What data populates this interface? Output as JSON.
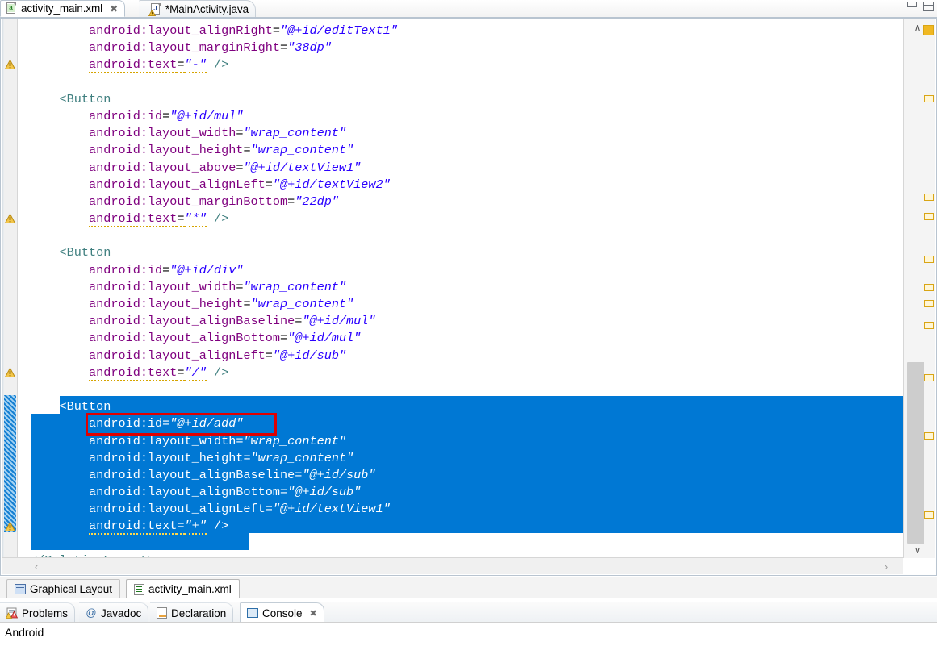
{
  "window": {
    "minimize_label": "Minimize",
    "maximize_label": "Maximize"
  },
  "editor_tabs": [
    {
      "label": "activity_main.xml",
      "icon": "xml-file-icon",
      "active": true,
      "close_glyph": "✖",
      "dirty": false
    },
    {
      "label": "*MainActivity.java",
      "icon": "java-file-icon",
      "active": false,
      "close_glyph": "",
      "dirty": true
    }
  ],
  "code": {
    "lines": [
      {
        "indent": 2,
        "segments": [
          {
            "t": "attr",
            "s": "android:layout_alignRight"
          },
          {
            "t": "punc",
            "s": "="
          },
          {
            "t": "val",
            "s": "\"@+id/editText1\""
          }
        ]
      },
      {
        "indent": 2,
        "segments": [
          {
            "t": "attr",
            "s": "android:layout_marginRight"
          },
          {
            "t": "punc",
            "s": "="
          },
          {
            "t": "val",
            "s": "\"38dp\""
          }
        ]
      },
      {
        "indent": 2,
        "warn": true,
        "segments": [
          {
            "t": "attr",
            "s": "android:text",
            "squig": true
          },
          {
            "t": "punc",
            "s": "=",
            "squig": true
          },
          {
            "t": "val",
            "s": "\"-\"",
            "squig": true
          },
          {
            "t": "plain",
            "s": " "
          },
          {
            "t": "slash",
            "s": "/>"
          }
        ]
      },
      {
        "indent": 0,
        "segments": []
      },
      {
        "indent": 1,
        "segments": [
          {
            "t": "tag",
            "s": "<Button"
          }
        ]
      },
      {
        "indent": 2,
        "segments": [
          {
            "t": "attr",
            "s": "android:id"
          },
          {
            "t": "punc",
            "s": "="
          },
          {
            "t": "val",
            "s": "\"@+id/mul\""
          }
        ]
      },
      {
        "indent": 2,
        "segments": [
          {
            "t": "attr",
            "s": "android:layout_width"
          },
          {
            "t": "punc",
            "s": "="
          },
          {
            "t": "val",
            "s": "\"wrap_content\""
          }
        ]
      },
      {
        "indent": 2,
        "segments": [
          {
            "t": "attr",
            "s": "android:layout_height"
          },
          {
            "t": "punc",
            "s": "="
          },
          {
            "t": "val",
            "s": "\"wrap_content\""
          }
        ]
      },
      {
        "indent": 2,
        "segments": [
          {
            "t": "attr",
            "s": "android:layout_above"
          },
          {
            "t": "punc",
            "s": "="
          },
          {
            "t": "val",
            "s": "\"@+id/textView1\""
          }
        ]
      },
      {
        "indent": 2,
        "segments": [
          {
            "t": "attr",
            "s": "android:layout_alignLeft"
          },
          {
            "t": "punc",
            "s": "="
          },
          {
            "t": "val",
            "s": "\"@+id/textView2\""
          }
        ]
      },
      {
        "indent": 2,
        "segments": [
          {
            "t": "attr",
            "s": "android:layout_marginBottom"
          },
          {
            "t": "punc",
            "s": "="
          },
          {
            "t": "val",
            "s": "\"22dp\""
          }
        ]
      },
      {
        "indent": 2,
        "warn": true,
        "segments": [
          {
            "t": "attr",
            "s": "android:text",
            "squig": true
          },
          {
            "t": "punc",
            "s": "=",
            "squig": true
          },
          {
            "t": "val",
            "s": "\"*\"",
            "squig": true
          },
          {
            "t": "plain",
            "s": " "
          },
          {
            "t": "slash",
            "s": "/>"
          }
        ]
      },
      {
        "indent": 0,
        "segments": []
      },
      {
        "indent": 1,
        "segments": [
          {
            "t": "tag",
            "s": "<Button"
          }
        ]
      },
      {
        "indent": 2,
        "segments": [
          {
            "t": "attr",
            "s": "android:id"
          },
          {
            "t": "punc",
            "s": "="
          },
          {
            "t": "val",
            "s": "\"@+id/div\""
          }
        ]
      },
      {
        "indent": 2,
        "segments": [
          {
            "t": "attr",
            "s": "android:layout_width"
          },
          {
            "t": "punc",
            "s": "="
          },
          {
            "t": "val",
            "s": "\"wrap_content\""
          }
        ]
      },
      {
        "indent": 2,
        "segments": [
          {
            "t": "attr",
            "s": "android:layout_height"
          },
          {
            "t": "punc",
            "s": "="
          },
          {
            "t": "val",
            "s": "\"wrap_content\""
          }
        ]
      },
      {
        "indent": 2,
        "segments": [
          {
            "t": "attr",
            "s": "android:layout_alignBaseline"
          },
          {
            "t": "punc",
            "s": "="
          },
          {
            "t": "val",
            "s": "\"@+id/mul\""
          }
        ]
      },
      {
        "indent": 2,
        "segments": [
          {
            "t": "attr",
            "s": "android:layout_alignBottom"
          },
          {
            "t": "punc",
            "s": "="
          },
          {
            "t": "val",
            "s": "\"@+id/mul\""
          }
        ]
      },
      {
        "indent": 2,
        "segments": [
          {
            "t": "attr",
            "s": "android:layout_alignLeft"
          },
          {
            "t": "punc",
            "s": "="
          },
          {
            "t": "val",
            "s": "\"@+id/sub\""
          }
        ]
      },
      {
        "indent": 2,
        "warn": true,
        "segments": [
          {
            "t": "attr",
            "s": "android:text",
            "squig": true
          },
          {
            "t": "punc",
            "s": "=",
            "squig": true
          },
          {
            "t": "val",
            "s": "\"/\"",
            "squig": true
          },
          {
            "t": "plain",
            "s": " "
          },
          {
            "t": "slash",
            "s": "/>"
          }
        ]
      },
      {
        "indent": 0,
        "segments": []
      },
      {
        "indent": 1,
        "selected": true,
        "segments": [
          {
            "t": "tag",
            "s": "<Button"
          }
        ]
      },
      {
        "indent": 2,
        "selected": true,
        "boxed": true,
        "segments": [
          {
            "t": "attr",
            "s": "android:id"
          },
          {
            "t": "punc",
            "s": "="
          },
          {
            "t": "val",
            "s": "\"@+id/add\""
          }
        ]
      },
      {
        "indent": 2,
        "selected": true,
        "segments": [
          {
            "t": "attr",
            "s": "android:layout_width"
          },
          {
            "t": "punc",
            "s": "="
          },
          {
            "t": "val",
            "s": "\"wrap_content\""
          }
        ]
      },
      {
        "indent": 2,
        "selected": true,
        "segments": [
          {
            "t": "attr",
            "s": "android:layout_height"
          },
          {
            "t": "punc",
            "s": "="
          },
          {
            "t": "val",
            "s": "\"wrap_content\""
          }
        ]
      },
      {
        "indent": 2,
        "selected": true,
        "segments": [
          {
            "t": "attr",
            "s": "android:layout_alignBaseline"
          },
          {
            "t": "punc",
            "s": "="
          },
          {
            "t": "val",
            "s": "\"@+id/sub\""
          }
        ]
      },
      {
        "indent": 2,
        "selected": true,
        "segments": [
          {
            "t": "attr",
            "s": "android:layout_alignBottom"
          },
          {
            "t": "punc",
            "s": "="
          },
          {
            "t": "val",
            "s": "\"@+id/sub\""
          }
        ]
      },
      {
        "indent": 2,
        "selected": true,
        "segments": [
          {
            "t": "attr",
            "s": "android:layout_alignLeft"
          },
          {
            "t": "punc",
            "s": "="
          },
          {
            "t": "val",
            "s": "\"@+id/textView1\""
          }
        ]
      },
      {
        "indent": 2,
        "selected": true,
        "warn": true,
        "segments": [
          {
            "t": "attr",
            "s": "android:text",
            "squig": true
          },
          {
            "t": "punc",
            "s": "=",
            "squig": true
          },
          {
            "t": "val",
            "s": "\"+\"",
            "squig": true
          },
          {
            "t": "plain",
            "s": " "
          },
          {
            "t": "slash",
            "s": "/>"
          }
        ]
      },
      {
        "indent": 0,
        "segments": []
      },
      {
        "indent": 0,
        "segments": [
          {
            "t": "tag",
            "s": "</RelativeLayout>"
          }
        ]
      }
    ]
  },
  "scrollbars": {
    "vertical_up_glyph": "∧",
    "vertical_down_glyph": "∨",
    "horizontal_left_glyph": "‹",
    "horizontal_right_glyph": "›"
  },
  "editor_bottom_tabs": [
    {
      "label": "Graphical Layout",
      "icon": "graphical-layout-icon",
      "active": false
    },
    {
      "label": "activity_main.xml",
      "icon": "xml-source-icon",
      "active": true
    }
  ],
  "view_tabs": [
    {
      "label": "Problems",
      "icon": "problems-icon",
      "active": false,
      "close_glyph": ""
    },
    {
      "label": "Javadoc",
      "icon": "javadoc-icon",
      "active": false,
      "close_glyph": ""
    },
    {
      "label": "Declaration",
      "icon": "declaration-icon",
      "active": false,
      "close_glyph": ""
    },
    {
      "label": "Console",
      "icon": "console-icon",
      "active": true,
      "close_glyph": "✖"
    }
  ],
  "console": {
    "content": "Android"
  },
  "colors": {
    "selection": "#0078d4",
    "annotation_box": "#e00000",
    "tag": "#3f7f7f",
    "attribute": "#7f007f",
    "value": "#2a00ff",
    "warning_marker": "#f0b823"
  }
}
